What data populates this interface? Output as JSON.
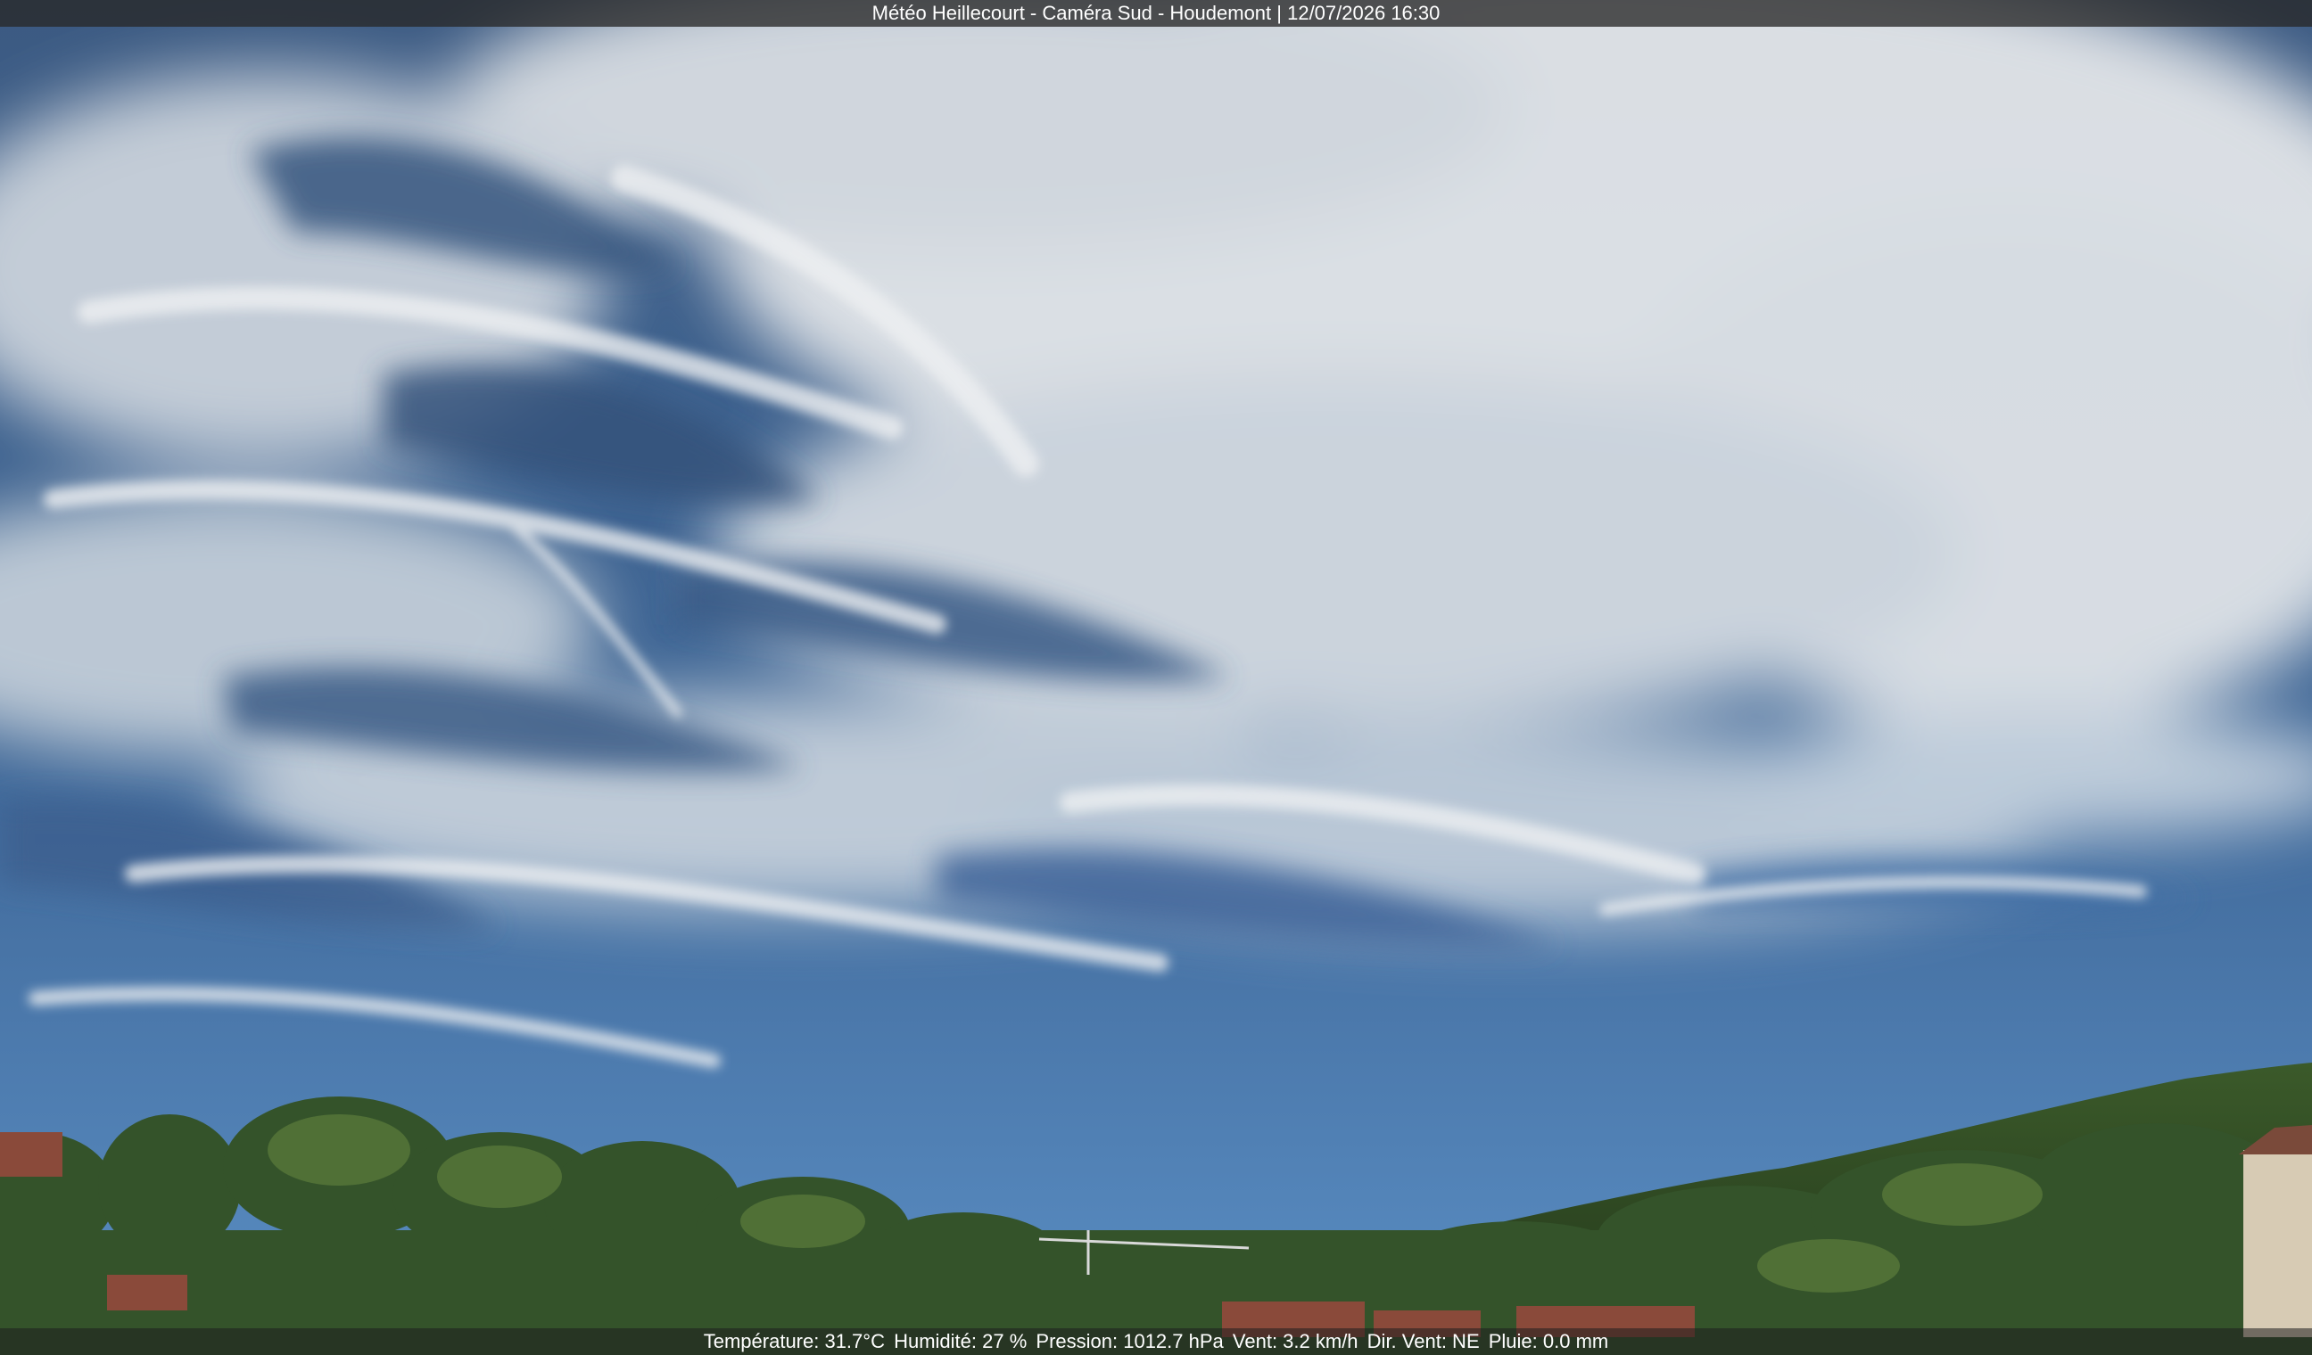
{
  "header": {
    "caption": "Météo Heillecourt - Caméra Sud - Houdemont | 12/07/2026 16:30"
  },
  "footer": {
    "temperature": "Température: 31.7°C",
    "humidity": "Humidité: 27 %",
    "pressure": "Pression: 1012.7 hPa",
    "wind": "Vent: 3.2 km/h",
    "wind_dir": "Dir. Vent: NE",
    "rain": "Pluie: 0.0 mm"
  },
  "colors": {
    "sky_top": "#2f4d77",
    "sky_bottom": "#4f82b8",
    "cloud": "#e9ecee",
    "trees": "#3f5f2c"
  }
}
